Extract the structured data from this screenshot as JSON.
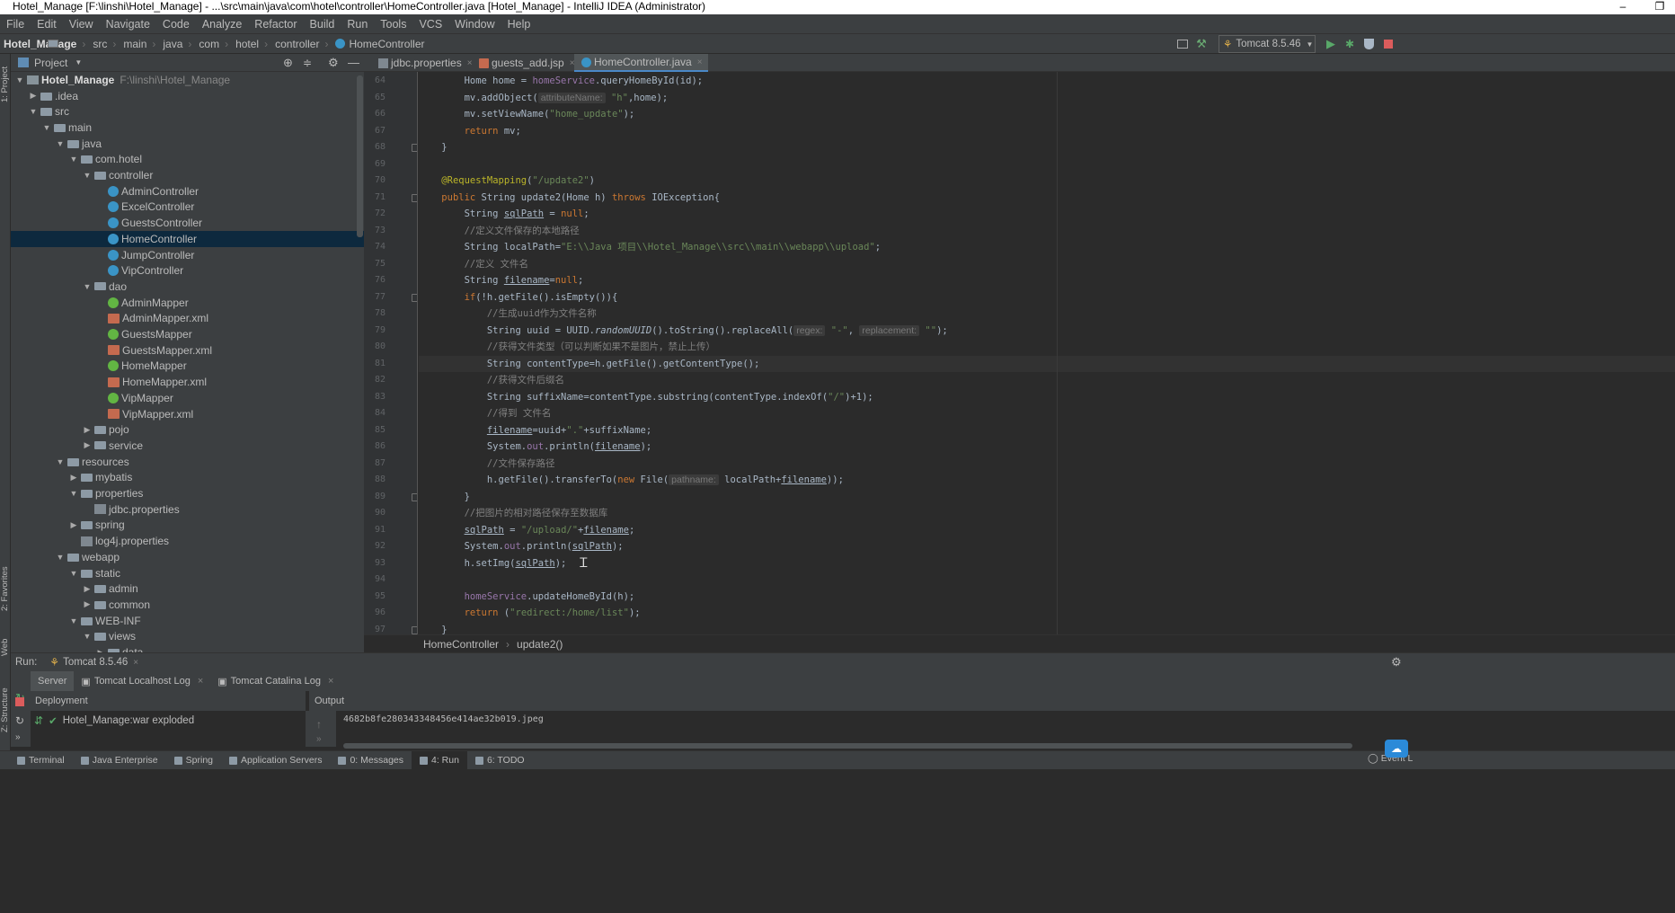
{
  "window": {
    "title": "Hotel_Manage [F:\\linshi\\Hotel_Manage] - ...\\src\\main\\java\\com\\hotel\\controller\\HomeController.java [Hotel_Manage] - IntelliJ IDEA (Administrator)",
    "minimize": "–",
    "maximize": "❐"
  },
  "menu": [
    "File",
    "Edit",
    "View",
    "Navigate",
    "Code",
    "Analyze",
    "Refactor",
    "Build",
    "Run",
    "Tools",
    "VCS",
    "Window",
    "Help"
  ],
  "nav": {
    "project": "Hotel_Manage",
    "crumbs": [
      "src",
      "main",
      "java",
      "com",
      "hotel",
      "controller"
    ],
    "file": "HomeController",
    "run_config": "Tomcat 8.5.46"
  },
  "project_panel": {
    "title": "Project",
    "tree": [
      {
        "label": "Hotel_Manage",
        "hint": "F:\\linshi\\Hotel_Manage",
        "icon": "module-icon",
        "arrow": "down"
      },
      {
        "label": ".idea",
        "icon": "folder-icon",
        "arrow": "right"
      },
      {
        "label": "src",
        "icon": "folder-icon",
        "arrow": "down"
      },
      {
        "label": "main",
        "icon": "folder-icon",
        "arrow": "down"
      },
      {
        "label": "java",
        "icon": "folder-icon",
        "arrow": "down"
      },
      {
        "label": "com.hotel",
        "icon": "package-icon",
        "arrow": "down"
      },
      {
        "label": "controller",
        "icon": "package-icon",
        "arrow": "down"
      },
      {
        "label": "AdminController",
        "icon": "class-icon",
        "arrow": ""
      },
      {
        "label": "ExcelController",
        "icon": "class-icon",
        "arrow": ""
      },
      {
        "label": "GuestsController",
        "icon": "class-icon",
        "arrow": ""
      },
      {
        "label": "HomeController",
        "icon": "class-icon",
        "arrow": "",
        "selected": true
      },
      {
        "label": "JumpController",
        "icon": "class-icon",
        "arrow": ""
      },
      {
        "label": "VipController",
        "icon": "class-icon",
        "arrow": ""
      },
      {
        "label": "dao",
        "icon": "package-icon",
        "arrow": "down"
      },
      {
        "label": "AdminMapper",
        "icon": "interface-icon",
        "arrow": ""
      },
      {
        "label": "AdminMapper.xml",
        "icon": "xml-icon",
        "arrow": ""
      },
      {
        "label": "GuestsMapper",
        "icon": "interface-icon",
        "arrow": ""
      },
      {
        "label": "GuestsMapper.xml",
        "icon": "xml-icon",
        "arrow": ""
      },
      {
        "label": "HomeMapper",
        "icon": "interface-icon",
        "arrow": ""
      },
      {
        "label": "HomeMapper.xml",
        "icon": "xml-icon",
        "arrow": ""
      },
      {
        "label": "VipMapper",
        "icon": "interface-icon",
        "arrow": ""
      },
      {
        "label": "VipMapper.xml",
        "icon": "xml-icon",
        "arrow": ""
      },
      {
        "label": "pojo",
        "icon": "package-icon",
        "arrow": "right"
      },
      {
        "label": "service",
        "icon": "package-icon",
        "arrow": "right"
      },
      {
        "label": "resources",
        "icon": "folder-icon",
        "arrow": "down"
      },
      {
        "label": "mybatis",
        "icon": "folder-icon",
        "arrow": "right"
      },
      {
        "label": "properties",
        "icon": "folder-icon",
        "arrow": "down"
      },
      {
        "label": "jdbc.properties",
        "icon": "properties-file-icon",
        "arrow": ""
      },
      {
        "label": "spring",
        "icon": "folder-icon",
        "arrow": "right"
      },
      {
        "label": "log4j.properties",
        "icon": "properties-file-icon",
        "arrow": ""
      },
      {
        "label": "webapp",
        "icon": "folder-icon",
        "arrow": "down"
      },
      {
        "label": "static",
        "icon": "folder-icon",
        "arrow": "down"
      },
      {
        "label": "admin",
        "icon": "folder-icon",
        "arrow": "right"
      },
      {
        "label": "common",
        "icon": "folder-icon",
        "arrow": "right"
      },
      {
        "label": "WEB-INF",
        "icon": "folder-icon",
        "arrow": "down"
      },
      {
        "label": "views",
        "icon": "folder-icon",
        "arrow": "down"
      },
      {
        "label": "data",
        "icon": "folder-icon",
        "arrow": "right"
      }
    ]
  },
  "left_stripe": {
    "project": "1: Project",
    "favorites": "2: Favorites",
    "web": "Web",
    "structure": "Z: Structure"
  },
  "editor_tabs": [
    {
      "label": "jdbc.properties",
      "active": false
    },
    {
      "label": "guests_add.jsp",
      "active": false
    },
    {
      "label": "HomeController.java",
      "active": true
    }
  ],
  "code_lines": [
    {
      "n": "64",
      "segs": [
        [
          "        Home home = ",
          ""
        ],
        [
          "homeService",
          "fld"
        ],
        [
          ".queryHomeById(id);",
          ""
        ]
      ]
    },
    {
      "n": "65",
      "segs": [
        [
          "        mv.addObject(",
          ""
        ],
        [
          "attributeName:",
          "ph"
        ],
        [
          " ",
          ""
        ],
        [
          "\"h\"",
          "str"
        ],
        [
          ",home);",
          ""
        ]
      ]
    },
    {
      "n": "66",
      "segs": [
        [
          "        mv.setViewName(",
          ""
        ],
        [
          "\"home_update\"",
          "str"
        ],
        [
          ");",
          ""
        ]
      ]
    },
    {
      "n": "67",
      "segs": [
        [
          "        ",
          ""
        ],
        [
          "return",
          "kw"
        ],
        [
          " mv;",
          ""
        ]
      ]
    },
    {
      "n": "68",
      "segs": [
        [
          "    }",
          ""
        ]
      ]
    },
    {
      "n": "69",
      "segs": []
    },
    {
      "n": "70",
      "segs": [
        [
          "    ",
          ""
        ],
        [
          "@RequestMapping",
          "ann"
        ],
        [
          "(",
          ""
        ],
        [
          "\"/update2\"",
          "str"
        ],
        [
          ")",
          ""
        ]
      ]
    },
    {
      "n": "71",
      "segs": [
        [
          "    ",
          ""
        ],
        [
          "public",
          "kw"
        ],
        [
          " String update2(Home h) ",
          ""
        ],
        [
          "throws",
          "kw"
        ],
        [
          " IOException{",
          ""
        ]
      ]
    },
    {
      "n": "72",
      "segs": [
        [
          "        String ",
          ""
        ],
        [
          "sqlPath",
          "ul"
        ],
        [
          " = ",
          ""
        ],
        [
          "null",
          "kw"
        ],
        [
          ";",
          ""
        ]
      ]
    },
    {
      "n": "73",
      "segs": [
        [
          "        ",
          ""
        ],
        [
          "//定义文件保存的本地路径",
          "cm"
        ]
      ]
    },
    {
      "n": "74",
      "segs": [
        [
          "        String localPath=",
          ""
        ],
        [
          "\"E:\\\\Java 项目\\\\Hotel_Manage\\\\src\\\\main\\\\webapp\\\\upload\"",
          "str"
        ],
        [
          ";",
          ""
        ]
      ]
    },
    {
      "n": "75",
      "segs": [
        [
          "        ",
          ""
        ],
        [
          "//定义 文件名",
          "cm"
        ]
      ]
    },
    {
      "n": "76",
      "segs": [
        [
          "        String ",
          ""
        ],
        [
          "filename",
          "ul"
        ],
        [
          "=",
          ""
        ],
        [
          "null",
          "kw"
        ],
        [
          ";",
          ""
        ]
      ]
    },
    {
      "n": "77",
      "segs": [
        [
          "        ",
          ""
        ],
        [
          "if",
          "kw"
        ],
        [
          "(!h.getFile().isEmpty()){",
          ""
        ]
      ]
    },
    {
      "n": "78",
      "segs": [
        [
          "            ",
          ""
        ],
        [
          "//生成uuid作为文件名称",
          "cm"
        ]
      ]
    },
    {
      "n": "79",
      "segs": [
        [
          "            String uuid = UUID.",
          ""
        ],
        [
          "randomUUID",
          "ita"
        ],
        [
          "().toString().replaceAll(",
          ""
        ],
        [
          "regex:",
          "ph"
        ],
        [
          " ",
          ""
        ],
        [
          "\"-\"",
          "str"
        ],
        [
          ", ",
          ""
        ],
        [
          "replacement:",
          "ph"
        ],
        [
          " ",
          ""
        ],
        [
          "\"\"",
          "str"
        ],
        [
          ");",
          ""
        ]
      ]
    },
    {
      "n": "80",
      "segs": [
        [
          "            ",
          ""
        ],
        [
          "//获得文件类型（可以判断如果不是图片，禁止上传）",
          "cm"
        ]
      ]
    },
    {
      "n": "81",
      "segs": [
        [
          "            String contentType=h.getFile().getContentType();",
          ""
        ]
      ]
    },
    {
      "n": "82",
      "segs": [
        [
          "            ",
          ""
        ],
        [
          "//获得文件后缀名",
          "cm"
        ]
      ]
    },
    {
      "n": "83",
      "segs": [
        [
          "            String suffixName=contentType.substring(contentType.indexOf(",
          ""
        ],
        [
          "\"/\"",
          "str"
        ],
        [
          ")+1);",
          ""
        ]
      ]
    },
    {
      "n": "84",
      "segs": [
        [
          "            ",
          ""
        ],
        [
          "//得到 文件名",
          "cm"
        ]
      ]
    },
    {
      "n": "85",
      "segs": [
        [
          "            ",
          ""
        ],
        [
          "filename",
          "ul"
        ],
        [
          "=uuid+",
          ""
        ],
        [
          "\".\"",
          "str"
        ],
        [
          "+suffixName;",
          ""
        ]
      ]
    },
    {
      "n": "86",
      "segs": [
        [
          "            System.",
          ""
        ],
        [
          "out",
          "fld"
        ],
        [
          ".println(",
          ""
        ],
        [
          "filename",
          "ul"
        ],
        [
          ");",
          ""
        ]
      ]
    },
    {
      "n": "87",
      "segs": [
        [
          "            ",
          ""
        ],
        [
          "//文件保存路径",
          "cm"
        ]
      ]
    },
    {
      "n": "88",
      "segs": [
        [
          "            h.getFile().transferTo(",
          ""
        ],
        [
          "new",
          "kw"
        ],
        [
          " File(",
          ""
        ],
        [
          "pathname:",
          "ph"
        ],
        [
          " localPath+",
          ""
        ],
        [
          "filename",
          "ul"
        ],
        [
          "));",
          ""
        ]
      ]
    },
    {
      "n": "89",
      "segs": [
        [
          "        }",
          ""
        ]
      ]
    },
    {
      "n": "90",
      "segs": [
        [
          "        ",
          ""
        ],
        [
          "//把图片的相对路径保存至数据库",
          "cm"
        ]
      ]
    },
    {
      "n": "91",
      "segs": [
        [
          "        ",
          ""
        ],
        [
          "sqlPath",
          "ul"
        ],
        [
          " = ",
          ""
        ],
        [
          "\"/upload/\"",
          "str"
        ],
        [
          "+",
          ""
        ],
        [
          "filename",
          "ul"
        ],
        [
          ";",
          ""
        ]
      ]
    },
    {
      "n": "92",
      "segs": [
        [
          "        System.",
          ""
        ],
        [
          "out",
          "fld"
        ],
        [
          ".println(",
          ""
        ],
        [
          "sqlPath",
          "ul"
        ],
        [
          ");",
          ""
        ]
      ]
    },
    {
      "n": "93",
      "segs": [
        [
          "        h.setImg(",
          ""
        ],
        [
          "sqlPath",
          "ul"
        ],
        [
          ");",
          ""
        ]
      ]
    },
    {
      "n": "94",
      "segs": []
    },
    {
      "n": "95",
      "segs": [
        [
          "        ",
          ""
        ],
        [
          "homeService",
          "fld"
        ],
        [
          ".updateHomeById(h);",
          ""
        ]
      ]
    },
    {
      "n": "96",
      "segs": [
        [
          "        ",
          ""
        ],
        [
          "return",
          "kw"
        ],
        [
          " (",
          ""
        ],
        [
          "\"redirect:/home/list\"",
          "str"
        ],
        [
          ");",
          ""
        ]
      ]
    },
    {
      "n": "97",
      "segs": [
        [
          "    }",
          ""
        ]
      ]
    }
  ],
  "editor_breadcrumb": {
    "cls": "HomeController",
    "method": "update2()"
  },
  "run_panel": {
    "label": "Run:",
    "config": "Tomcat 8.5.46",
    "tabs": [
      "Server",
      "Tomcat Localhost Log",
      "Tomcat Catalina Log"
    ],
    "deployment_header": "Deployment",
    "output_header": "Output",
    "deployment_item": "Hotel_Manage:war exploded",
    "output_line": "4682b8fe280343348456e414ae32b019.jpeg"
  },
  "bottom_tools": [
    {
      "label": "Terminal",
      "active": false
    },
    {
      "label": "Java Enterprise",
      "active": false
    },
    {
      "label": "Spring",
      "active": false
    },
    {
      "label": "Application Servers",
      "active": false
    },
    {
      "label": "0: Messages",
      "active": false
    },
    {
      "label": "4: Run",
      "active": true
    },
    {
      "label": "6: TODO",
      "active": false
    }
  ],
  "event_log": "Event L",
  "colors": {
    "selection": "#0d293e",
    "accent": "#4a88c7",
    "keyword": "#cc7832",
    "string": "#6a8759",
    "comment": "#808080"
  }
}
